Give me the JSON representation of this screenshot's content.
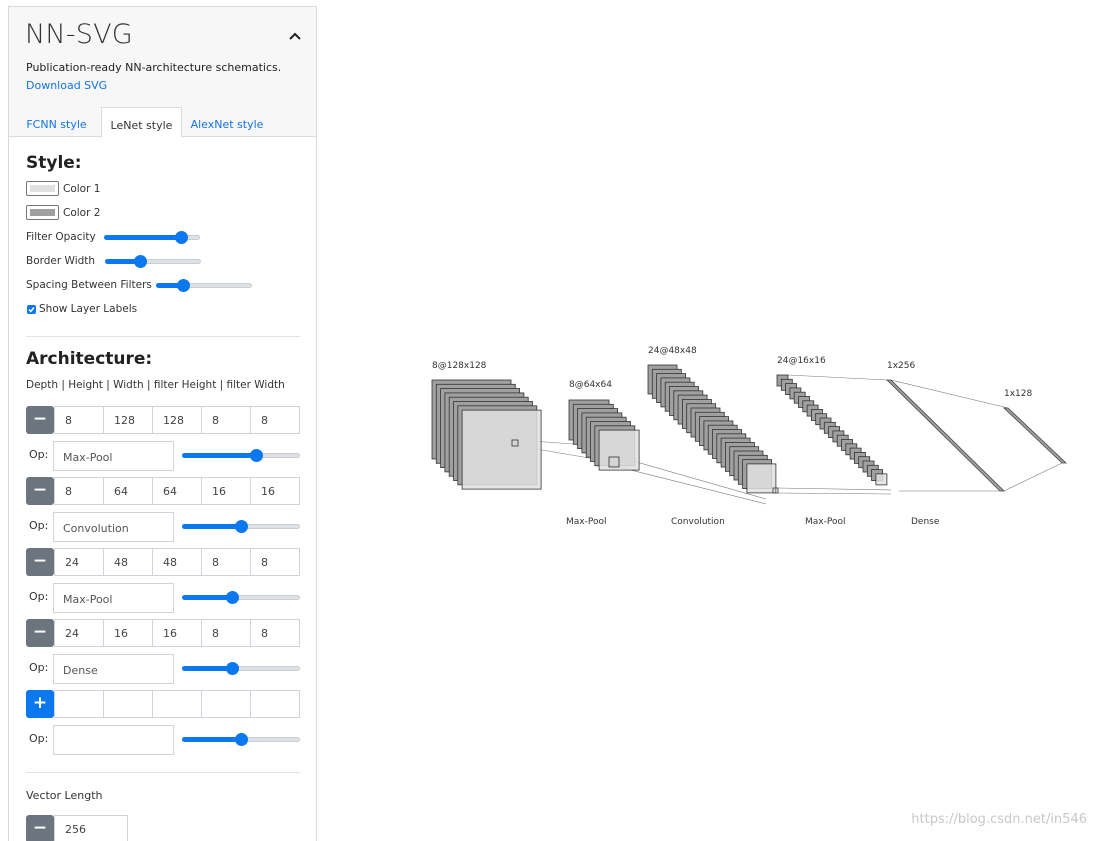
{
  "app": {
    "title": "NN-SVG",
    "subtitle": "Publication-ready NN-architecture schematics.",
    "download": "Download SVG"
  },
  "tabs": [
    {
      "label": "FCNN style",
      "active": false
    },
    {
      "label": "LeNet style",
      "active": true
    },
    {
      "label": "AlexNet style",
      "active": false
    }
  ],
  "style": {
    "title": "Style:",
    "color1_label": "Color 1",
    "color1_value": "#e0e0e0",
    "color2_label": "Color 2",
    "color2_value": "#a0a0a0",
    "filter_opacity_label": "Filter Opacity",
    "filter_opacity_level": 0.85,
    "border_width_label": "Border Width",
    "border_width_level": 0.35,
    "spacing_label": "Spacing Between Filters",
    "spacing_level": 0.25,
    "show_labels_label": "Show Layer Labels",
    "show_labels_checked": true
  },
  "architecture": {
    "title": "Architecture:",
    "columns_label": "Depth | Height | Width | filter Height | filter Width",
    "layers": [
      {
        "values": [
          "8",
          "128",
          "128",
          "8",
          "8"
        ],
        "op": "Max-Pool",
        "op_level": 0.65
      },
      {
        "values": [
          "8",
          "64",
          "64",
          "16",
          "16"
        ],
        "op": "Convolution",
        "op_level": 0.5
      },
      {
        "values": [
          "24",
          "48",
          "48",
          "8",
          "8"
        ],
        "op": "Max-Pool",
        "op_level": 0.42
      },
      {
        "values": [
          "24",
          "16",
          "16",
          "8",
          "8"
        ],
        "op": "Dense",
        "op_level": 0.42
      }
    ],
    "new_layer": {
      "values": [
        "",
        "",
        "",
        "",
        ""
      ],
      "op": "",
      "op_level": 0.5
    },
    "remove_icon": "minus-icon",
    "add_icon": "plus-icon"
  },
  "vector": {
    "title": "Vector Length",
    "value": "256"
  },
  "diagram": {
    "layer_labels": [
      "8@128x128",
      "8@64x64",
      "24@48x48",
      "24@16x16",
      "1x256",
      "1x128"
    ],
    "op_labels": [
      "Max-Pool",
      "Convolution",
      "Max-Pool",
      "Dense"
    ]
  },
  "colors": {
    "accent": "#0b78f0",
    "link": "#1473e6",
    "button_gray": "#6c757d"
  },
  "watermark": "https://blog.csdn.net/in546"
}
